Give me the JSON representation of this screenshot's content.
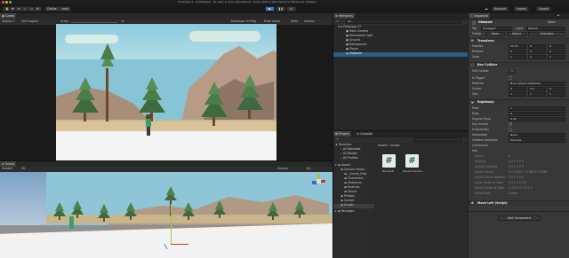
{
  "window": {
    "title": "Prototype 2 - PrototypeX - PC, Mac & Linux Standalone - Unity 2020.3.18f1 Personal (Personal) <Metal>"
  },
  "menubar": {
    "tools": [
      "✋",
      "✥",
      "⟳",
      "⤢",
      "▭",
      "⚙"
    ],
    "pivot": "Center",
    "global": "Local",
    "account": "Account",
    "layers": "Layers",
    "layout": "Layout"
  },
  "game_view": {
    "tab": "Game",
    "display": "Display 1",
    "aspect": "16:9 Aspect",
    "scale_label": "Scale",
    "scale_value": "1x",
    "maximize": "Maximize On Play",
    "mute": "Mute Audio",
    "stats": "Stats",
    "gizmos": "Gizmos"
  },
  "scene_view": {
    "tab": "Scene",
    "shaded": "Shaded",
    "mode_2d": "2D",
    "gizmos": "Gizmos",
    "search": "All"
  },
  "hierarchy": {
    "tab": "Hierarchy",
    "add": "+",
    "search": "All",
    "items": [
      {
        "label": "Prototype 2*",
        "indent": 0
      },
      {
        "label": "Main Camera",
        "indent": 1
      },
      {
        "label": "Directional Light",
        "indent": 1
      },
      {
        "label": "Ground",
        "indent": 1
      },
      {
        "label": "Background",
        "indent": 1
      },
      {
        "label": "Player",
        "indent": 1
      },
      {
        "label": "Obstacle",
        "indent": 1,
        "selected": true
      }
    ]
  },
  "project": {
    "tabs": [
      "Project",
      "Console"
    ],
    "add": "+",
    "favorites_label": "Favorites",
    "favorites": [
      "All Materials",
      "All Models",
      "All Prefabs"
    ],
    "assets_label": "Assets",
    "folders": [
      "Course Library",
      "_Course_Files",
      "Characters",
      "Obstacles",
      "Particles",
      "Sound",
      "Prefabs",
      "Scenes",
      "Scripts"
    ],
    "packages_label": "Packages",
    "breadcrumb": [
      "Assets",
      "Scripts"
    ],
    "files": [
      "MoveLeft",
      "PlayerControlle..."
    ]
  },
  "inspector": {
    "tab": "Inspector",
    "object_name": "Obstacle",
    "static": "Static",
    "tag_label": "Tag",
    "tag_value": "Untagged",
    "layer_label": "Layer",
    "layer_value": "Default",
    "prefab_label": "Prefab",
    "prefab_open": "Open",
    "prefab_select": "Select",
    "prefab_overrides": "Overrides",
    "transform": {
      "title": "Transform",
      "position": {
        "label": "Position",
        "x": "25.53",
        "y": "0",
        "z": "0"
      },
      "rotation": {
        "label": "Rotation",
        "x": "0",
        "y": "0",
        "z": "0"
      },
      "scale": {
        "label": "Scale",
        "x": "1",
        "y": "1",
        "z": "1"
      }
    },
    "box_collider": {
      "title": "Box Collider",
      "edit_collider": "Edit Collider",
      "is_trigger": "Is Trigger",
      "material_label": "Material",
      "material_value": "None (Physic Material)",
      "center_label": "Center",
      "center": {
        "x": "0",
        "y": "0.5",
        "z": "0"
      },
      "size_label": "Size",
      "size": {
        "x": "1",
        "y": "1",
        "z": "1"
      }
    },
    "rigidbody": {
      "title": "Rigidbody",
      "mass_label": "Mass",
      "mass": "1",
      "drag_label": "Drag",
      "drag": "0",
      "angular_drag_label": "Angular Drag",
      "angular_drag": "0.05",
      "use_gravity_label": "Use Gravity",
      "is_kinematic_label": "Is Kinematic",
      "interpolate_label": "Interpolate",
      "interpolate": "None",
      "collision_label": "Collision Detection",
      "collision": "Discrete",
      "constraints_label": "Constraints",
      "info_label": "Info",
      "info_rows": [
        {
          "label": "Speed",
          "value": "0"
        },
        {
          "label": "Velocity",
          "value": "X 0   Y 0   Z 0"
        },
        {
          "label": "Angular Velocity",
          "value": "X 0   Y 0   Z 0"
        },
        {
          "label": "Inertia Tensor",
          "value": "X 0.1666   Y 0.1666   Z 0.1666"
        },
        {
          "label": "Inertia Tensor Rotation",
          "value": "X 0   Y 0   Z 0"
        },
        {
          "label": "Local Center of Mass",
          "value": "X 0   Y 0.5   Z 0"
        },
        {
          "label": "World Center of Mass",
          "value": "X 25.53   Y 0.5   Z 0"
        },
        {
          "label": "Sleep State",
          "value": "Awake"
        }
      ]
    },
    "move_left": {
      "title": "Move Left (Script)"
    },
    "add_component": "Add Component"
  },
  "colors": {
    "selection": "#2c5d87",
    "panel": "#383838",
    "header": "#282828",
    "sky": "#86c6d8",
    "accent_blue": "#3a79bb"
  }
}
